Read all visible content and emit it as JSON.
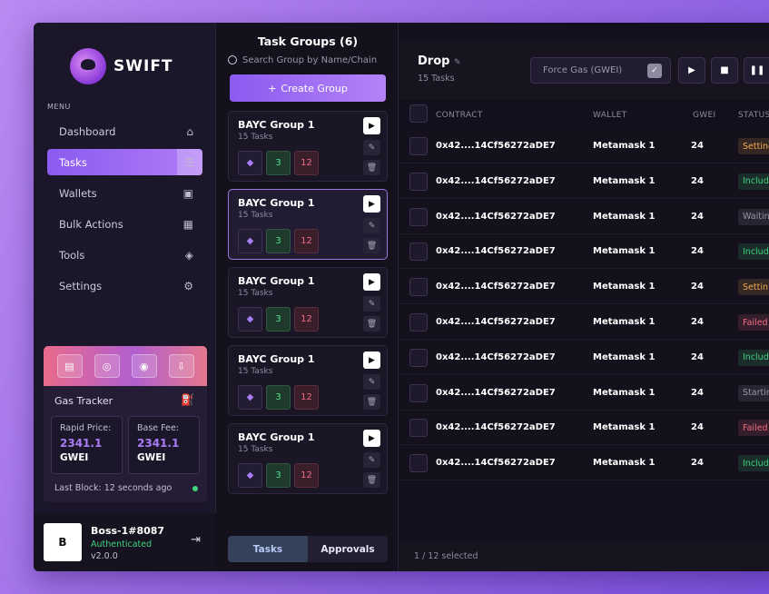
{
  "brand": {
    "name": "SWIFT"
  },
  "sidebar": {
    "menu_label": "MENU",
    "items": [
      {
        "label": "Dashboard",
        "icon": "home-icon",
        "glyph": "⌂"
      },
      {
        "label": "Tasks",
        "icon": "list-icon",
        "glyph": "☰"
      },
      {
        "label": "Wallets",
        "icon": "wallet-icon",
        "glyph": "▣"
      },
      {
        "label": "Bulk Actions",
        "icon": "grid-icon",
        "glyph": "▦"
      },
      {
        "label": "Tools",
        "icon": "layers-icon",
        "glyph": "◈"
      },
      {
        "label": "Settings",
        "icon": "gear-icon",
        "glyph": "⚙"
      }
    ]
  },
  "gas_tracker": {
    "title": "Gas Tracker",
    "rapid_label": "Rapid Price:",
    "rapid_value": "2341.1",
    "rapid_unit": "GWEI",
    "base_label": "Base Fee:",
    "base_value": "2341.1",
    "base_unit": "GWEI",
    "last_block": "Last Block: 12 seconds ago"
  },
  "user": {
    "initial": "B",
    "name": "Boss-1#8087",
    "status": "Authenticated",
    "version": "v2.0.0"
  },
  "groups": {
    "title": "Task Groups (6)",
    "search_placeholder": "Search Group by Name/Chain",
    "create_label": "Create Group",
    "cards": [
      {
        "name": "BAYC Group 1",
        "sub": "15 Tasks",
        "green": "3",
        "red": "12"
      },
      {
        "name": "BAYC Group 1",
        "sub": "15 Tasks",
        "green": "3",
        "red": "12"
      },
      {
        "name": "BAYC Group 1",
        "sub": "15 Tasks",
        "green": "3",
        "red": "12"
      },
      {
        "name": "BAYC Group 1",
        "sub": "15 Tasks",
        "green": "3",
        "red": "12"
      },
      {
        "name": "BAYC Group 1",
        "sub": "15 Tasks",
        "green": "3",
        "red": "12"
      }
    ],
    "tabs": [
      "Tasks",
      "Approvals"
    ]
  },
  "main": {
    "title": "Drop",
    "subtitle": "15 Tasks",
    "force_gas_label": "Force Gas (GWEI)",
    "columns": [
      "CONTRACT",
      "WALLET",
      "GWEI",
      "STATUS"
    ],
    "rows": [
      {
        "contract": "0x42....14Cf56272aDE7",
        "wallet": "Metamask 1",
        "gwei": "24",
        "status": "Setting",
        "color": "#f0a94f"
      },
      {
        "contract": "0x42....14Cf56272aDE7",
        "wallet": "Metamask 1",
        "gwei": "24",
        "status": "Includ",
        "color": "#3fd37c"
      },
      {
        "contract": "0x42....14Cf56272aDE7",
        "wallet": "Metamask 1",
        "gwei": "24",
        "status": "Waitin",
        "color": "#9b96ac"
      },
      {
        "contract": "0x42....14Cf56272aDE7",
        "wallet": "Metamask 1",
        "gwei": "24",
        "status": "Includ",
        "color": "#3fd37c"
      },
      {
        "contract": "0x42....14Cf56272aDE7",
        "wallet": "Metamask 1",
        "gwei": "24",
        "status": "Settin",
        "color": "#f0a94f"
      },
      {
        "contract": "0x42....14Cf56272aDE7",
        "wallet": "Metamask 1",
        "gwei": "24",
        "status": "Failed",
        "color": "#f06a82"
      },
      {
        "contract": "0x42....14Cf56272aDE7",
        "wallet": "Metamask 1",
        "gwei": "24",
        "status": "Includ",
        "color": "#3fd37c"
      },
      {
        "contract": "0x42....14Cf56272aDE7",
        "wallet": "Metamask 1",
        "gwei": "24",
        "status": "Startir",
        "color": "#9b96ac"
      },
      {
        "contract": "0x42....14Cf56272aDE7",
        "wallet": "Metamask 1",
        "gwei": "24",
        "status": "Failed",
        "color": "#f06a82"
      },
      {
        "contract": "0x42....14Cf56272aDE7",
        "wallet": "Metamask 1",
        "gwei": "24",
        "status": "Includ",
        "color": "#3fd37c"
      }
    ],
    "footer": "1 / 12 selected"
  }
}
